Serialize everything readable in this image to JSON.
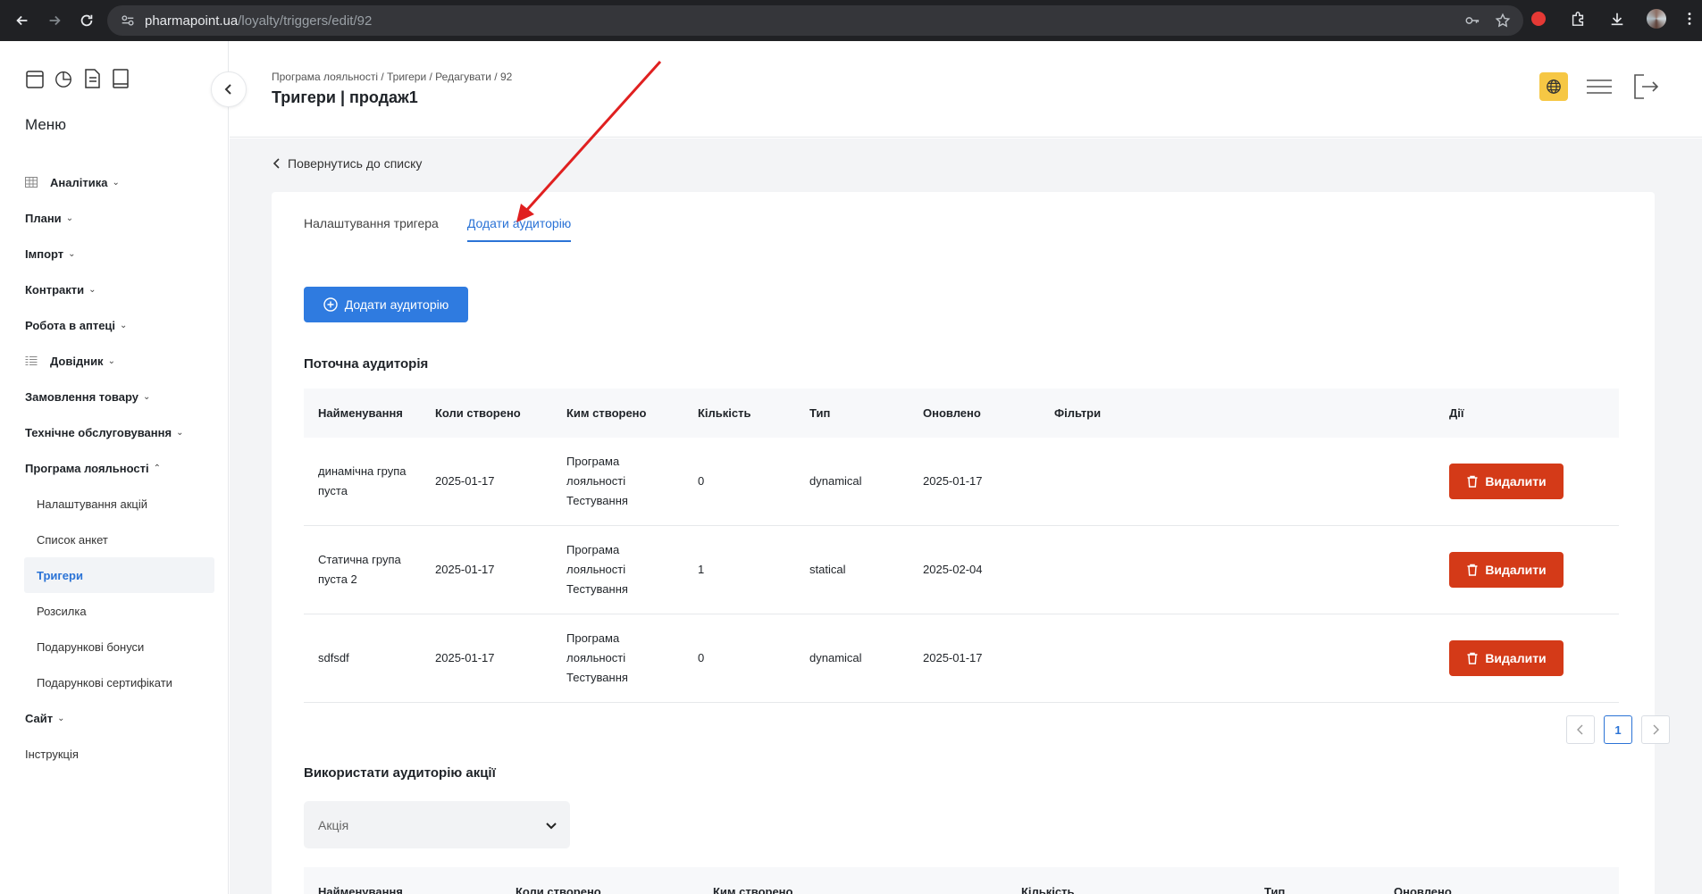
{
  "browser": {
    "url_host": "pharmapoint.ua",
    "url_path": "/loyalty/triggers/edit/92"
  },
  "sidebar": {
    "title": "Меню",
    "items": [
      {
        "label": "Аналітика",
        "icon": "table-icon"
      },
      {
        "label": "Плани"
      },
      {
        "label": "Імпорт"
      },
      {
        "label": "Контракти"
      },
      {
        "label": "Робота в аптеці"
      },
      {
        "label": "Довідник",
        "icon": "list-icon"
      },
      {
        "label": "Замовлення товару"
      },
      {
        "label": "Технічне обслуговування"
      },
      {
        "label": "Програма лояльності",
        "expanded": true
      }
    ],
    "subitems": [
      {
        "label": "Налаштування акцій"
      },
      {
        "label": "Список анкет"
      },
      {
        "label": "Тригери",
        "active": true
      },
      {
        "label": "Розсилка"
      },
      {
        "label": "Подарункові бонуси"
      },
      {
        "label": "Подарункові сертифікати"
      }
    ],
    "after_items": [
      {
        "label": "Сайт"
      }
    ],
    "plain_items": [
      {
        "label": "Інструкція"
      }
    ]
  },
  "header": {
    "breadcrumb": "Програма лояльності / Тригери / Редагувати / 92",
    "title": "Тригери | продаж1"
  },
  "main": {
    "back_label": "Повернутись до списку",
    "tabs": [
      {
        "label": "Налаштування тригера",
        "active": false
      },
      {
        "label": "Додати аудиторію",
        "active": true
      }
    ],
    "add_button": "Додати аудиторію",
    "current_title": "Поточна аудиторія",
    "columns": [
      "Найменування",
      "Коли створено",
      "Ким створено",
      "Кількість",
      "Тип",
      "Оновлено",
      "Фільтри",
      "Дії"
    ],
    "rows": [
      {
        "name": "динамічна група пуста",
        "created": "2025-01-17",
        "created_by": "Програма лояльності Тестування",
        "count": "0",
        "type": "dynamical",
        "updated": "2025-01-17",
        "filters": "",
        "action": "Видалити"
      },
      {
        "name": "Статична група пуста 2",
        "created": "2025-01-17",
        "created_by": "Програма лояльності Тестування",
        "count": "1",
        "type": "statical",
        "updated": "2025-02-04",
        "filters": "",
        "action": "Видалити"
      },
      {
        "name": "sdfsdf",
        "created": "2025-01-17",
        "created_by": "Програма лояльності Тестування",
        "count": "0",
        "type": "dynamical",
        "updated": "2025-01-17",
        "filters": "",
        "action": "Видалити"
      }
    ],
    "pagination": {
      "current": "1"
    },
    "use_title": "Використати аудиторію акції",
    "select_placeholder": "Акція",
    "columns2": [
      "Найменування",
      "Коли створено",
      "Ким створено",
      "Кількість",
      "Тип",
      "Оновлено"
    ]
  },
  "colors": {
    "accent": "#2f7be0",
    "danger": "#d43a18",
    "annotation": "#e02020"
  }
}
